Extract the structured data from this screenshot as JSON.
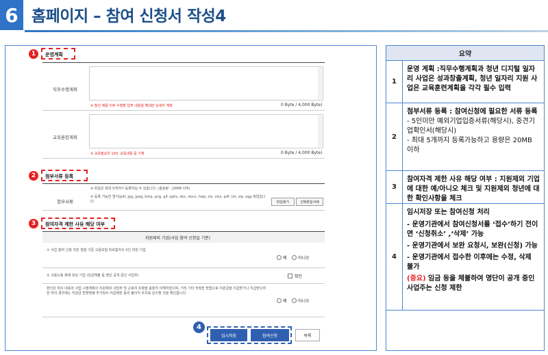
{
  "header": {
    "number": "6",
    "title": "홈페이지 – 참여 신청서 작성4"
  },
  "left_panel": {
    "badges": [
      "1",
      "2",
      "3",
      "4"
    ],
    "section1": {
      "title": "운영계획",
      "field1_label": "직무수행계획",
      "field1_note": "※ 청년 채용 이후 수행할 업무 내용을 확대한 상세히 계획",
      "field1_bytes": "0 Byte / 4,000 Byte)",
      "field2_label": "교육훈련계획",
      "field2_note": "※ 교육필요치 100, 교육내용 등 기재",
      "field2_bytes": "0 Byte / 4,000 Byte)"
    },
    "section2": {
      "title": "첨부서류 등록",
      "note1": "※ 파일은 최대 5개까지 등록하실 수 있습니다. (총용량 : 20MB 이하)",
      "row_label": "첨부서류",
      "note2": "※ 등록 가능한 형식(pdf, jpg, jpeg, bmp, png, gif, pptx, doc, docx, hwp, xls, xlsx, pdf, txt, zip, egg 파일입니다.",
      "btn_find": "파일찾기",
      "btn_delete": "선택파일삭제"
    },
    "section3": {
      "title": "참여자격 제한 사유 해당 여부",
      "table_header": "지원제외 기업(사업 참여 신청일 기준)",
      "q1": "① 사업 참여 신청 직전 월말 기준 고용보험 피보험자수 5인 미만 기업",
      "q2": "② 고용노동 제재 대상 기업 (임금체불 등 명단 공개 중인 사업주)",
      "q3": "본인은 위의 내용과 사업 시행계획의 지원제외 사업주 및 근로자 조항을 충분히 이해하였으며, 거짓 기타 부정한 방법으로 지원금을 지급받거나 지급받으려 한 자의 경우에는 지원금 반환명령·추가징수·지급제한 등의 불이익 조치를 감수할 것을 확인합니다.",
      "yes": "예",
      "no": "아니오",
      "confirm": "확인"
    },
    "buttons": {
      "temp_save": "임시저장",
      "apply": "참여신청",
      "list": "목록"
    }
  },
  "summary": {
    "header": "요약",
    "rows": [
      {
        "num": "1",
        "text": "운영 계획 :직무수행계획과 청년 디지털 일자리 사업은 성과창출계획, 청년 일자리 지원 사업은 교육훈련계획을 각각 필수 입력"
      },
      {
        "num": "2",
        "l1": "첨부서류 등록 : 참여신청에 필요한  서류 등록",
        "l2": "  - 5인미만 예외기업입증서류(해당시), 중견기업확인서(해당시)",
        "l3": "  - 최대 5개까지 등록가능하고 용량은 20MB 이하"
      },
      {
        "num": "3",
        "text": "참여자격 제한 사유 해당 여부  : 지원제외 기업에 대한 예/아니오 체크 및 지원제외 청년에 대한 확인사항을 체크"
      },
      {
        "num": "4",
        "l1": "임시저장 또는 참여신청 처리",
        "l2": " - 운영기관에서 참여신청서를 ‘접수’하기 전이면  ‘신청취소’ ,‘삭제’ 가능",
        "l3": " - 운영기관에서 보완 요청시, 보완(신청) 가능",
        "l4": " - 운영기관에서 접수한 이후에는  수정, 삭제 불가",
        "l5_red": "(중요)",
        "l5": " 임금 등을 체불하여 명단이 공개 중인 사업주는 신청 제한"
      }
    ]
  },
  "colors": {
    "accent": "#2e73c8",
    "title": "#1c4f8a",
    "badge_red": "#e52020",
    "badge_blue": "#2f5fb0"
  }
}
